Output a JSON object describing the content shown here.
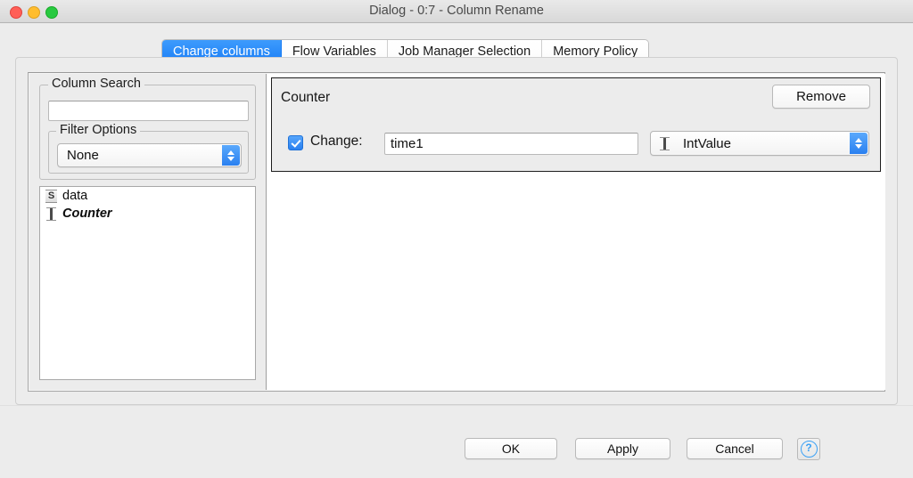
{
  "window": {
    "title": "Dialog - 0:7 - Column Rename",
    "traffic_lights": [
      "close",
      "minimize",
      "maximize"
    ]
  },
  "tabs": [
    {
      "label": "Change columns",
      "active": true
    },
    {
      "label": "Flow Variables",
      "active": false
    },
    {
      "label": "Job Manager Selection",
      "active": false
    },
    {
      "label": "Memory Policy",
      "active": false
    }
  ],
  "left_panel": {
    "column_search": {
      "title": "Column Search",
      "value": "",
      "placeholder": ""
    },
    "filter_options": {
      "title": "Filter Options",
      "selected": "None"
    },
    "column_list": [
      {
        "icon": "string-type-icon",
        "icon_glyph": "S",
        "label": "data",
        "italic": false
      },
      {
        "icon": "int-type-icon",
        "icon_glyph": "I",
        "label": "Counter",
        "italic": true
      }
    ]
  },
  "right_panel": {
    "counter": {
      "title": "Counter",
      "remove_label": "Remove",
      "change_checked": true,
      "change_label": "Change:",
      "rename_value": "time1",
      "rename_placeholder": "",
      "type_selected": "IntValue",
      "type_icon": "int-type-icon"
    }
  },
  "footer": {
    "ok_label": "OK",
    "apply_label": "Apply",
    "cancel_label": "Cancel",
    "help_label": "?"
  },
  "colors": {
    "accent_blue": "#2a80f0",
    "tab_active": "#1a7df5",
    "window_bg": "#ececec",
    "help_blue": "#3aa0f5"
  }
}
